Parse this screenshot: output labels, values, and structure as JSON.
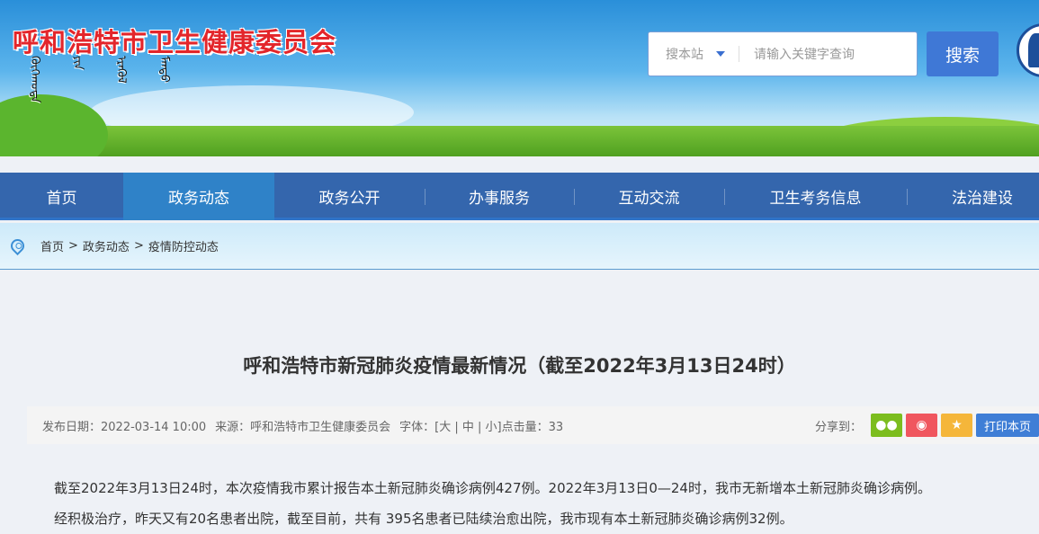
{
  "header": {
    "site_title": "呼和浩特市卫生健康委员会",
    "mongolian_subtitle": "ᠬᠥᠬᠡᠬᠣᠲᠠ ᠶᠢᠨ ᠡᠷᠡᠭᠦᠯ ᠮᠡᠨᠳᠦ"
  },
  "search": {
    "scope": "搜本站",
    "placeholder": "请输入关键字查询",
    "button": "搜索"
  },
  "nav": [
    "首页",
    "政务动态",
    "政务公开",
    "办事服务",
    "互动交流",
    "卫生考务信息",
    "法治建设"
  ],
  "nav_active": 1,
  "breadcrumb": [
    "首页",
    ">",
    "政务动态",
    ">",
    "疫情防控动态"
  ],
  "article": {
    "title": "呼和浩特市新冠肺炎疫情最新情况（截至2022年3月13日24时）",
    "date": "发布日期：2022-03-14 10:00",
    "source": "来源：呼和浩特市卫生健康委员会",
    "font_size": "字体：[大 | 中 | 小]",
    "views": "点击量：33",
    "share_label": "分享到：",
    "print": "打印本页",
    "paragraphs": [
      "截至2022年3月13日24时，本次疫情我市累计报告本土新冠肺炎确诊病例427例。2022年3月13日0—24时，我市无新增本土新冠肺炎确诊病例。",
      "经积极治疗，昨天又有20名患者出院，截至目前，共有 395名患者已陆续治愈出院，我市现有本土新冠肺炎确诊病例32例。"
    ]
  },
  "colors": {
    "nav": "#3466ad",
    "nav_active": "#2f82c8",
    "wechat": "#7cbd1e",
    "weibo": "#f0565e",
    "favorite": "#f5b63a"
  }
}
